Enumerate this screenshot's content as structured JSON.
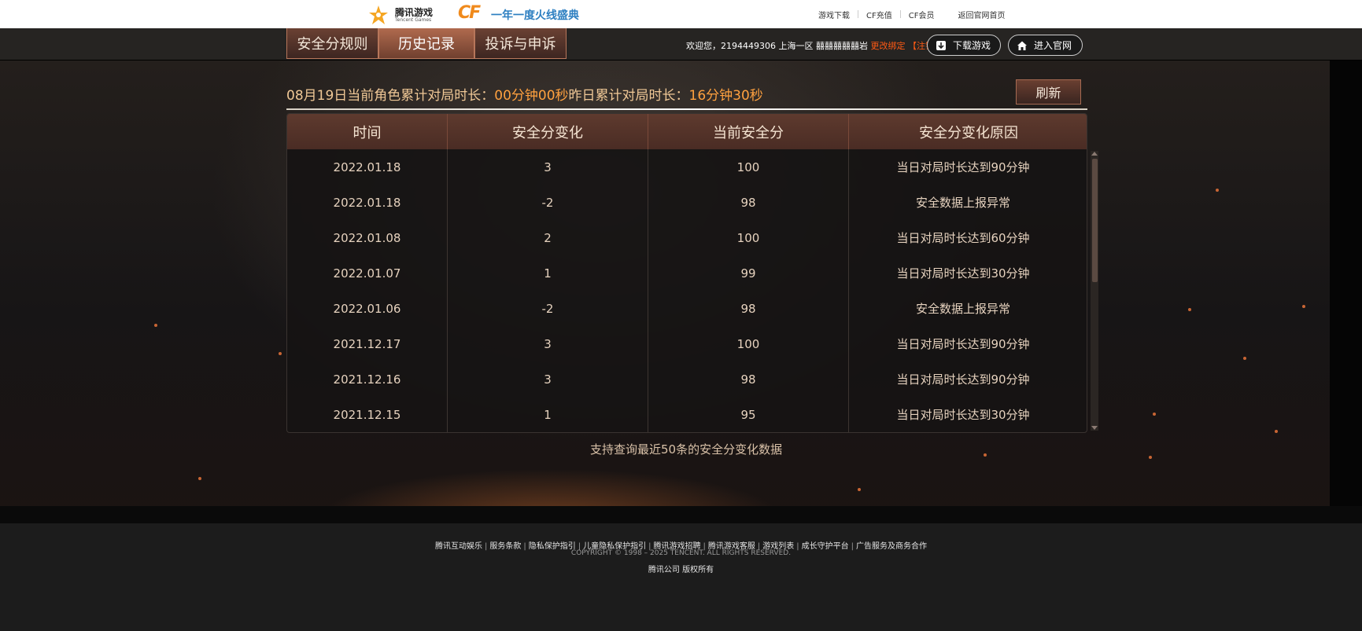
{
  "header": {
    "tencent_logo": {
      "name": "腾讯游戏",
      "sub": "Tencent Games"
    },
    "cf_logo": {
      "mark": "CF",
      "slogan": "一年一度火线盛典"
    },
    "links": [
      "游戏下载",
      "CF充值",
      "CF会员"
    ],
    "back_link": "返回官网首页"
  },
  "nav": {
    "tabs": [
      "安全分规则",
      "历史记录",
      "投诉与申诉"
    ],
    "active_tab": "历史记录",
    "welcome": "欢迎您，2194449306 上海一区 囍囍囍囍囍岩",
    "change_bind": "更改绑定",
    "logout": "【注销】",
    "download_button": "下载游戏",
    "official_button": "进入官网"
  },
  "stats": {
    "label_today": "08月19日当前角色累计对局时长：",
    "today_value": "00分钟00秒",
    "label_yesterday": "昨日累计对局时长：",
    "yesterday_value": "16分钟30秒",
    "refresh": "刷新"
  },
  "table": {
    "headers": [
      "时间",
      "安全分变化",
      "当前安全分",
      "安全分变化原因"
    ],
    "rows": [
      [
        "2022.01.18",
        "3",
        "100",
        "当日对局时长达到90分钟"
      ],
      [
        "2022.01.18",
        "-2",
        "98",
        "安全数据上报异常"
      ],
      [
        "2022.01.08",
        "2",
        "100",
        "当日对局时长达到60分钟"
      ],
      [
        "2022.01.07",
        "1",
        "99",
        "当日对局时长达到30分钟"
      ],
      [
        "2022.01.06",
        "-2",
        "98",
        "安全数据上报异常"
      ],
      [
        "2021.12.17",
        "3",
        "100",
        "当日对局时长达到90分钟"
      ],
      [
        "2021.12.16",
        "3",
        "98",
        "当日对局时长达到90分钟"
      ],
      [
        "2021.12.15",
        "1",
        "95",
        "当日对局时长达到30分钟"
      ]
    ],
    "note": "支持查询最近50条的安全分变化数据"
  },
  "footer": {
    "links": [
      "腾讯互动娱乐",
      "服务条款",
      "隐私保护指引",
      "儿童隐私保护指引",
      "腾讯游戏招聘",
      "腾讯游戏客服",
      "游戏列表",
      "成长守护平台",
      "广告服务及商务合作"
    ],
    "copyright": "COPYRIGHT © 1998 – 2025 TENCENT. ALL RIGHTS RESERVED.",
    "company": "腾讯公司 版权所有"
  },
  "colors": {
    "accent_orange": "#ffa13f",
    "warning": "#ff5a14",
    "header_bg": "#4a2c24"
  }
}
